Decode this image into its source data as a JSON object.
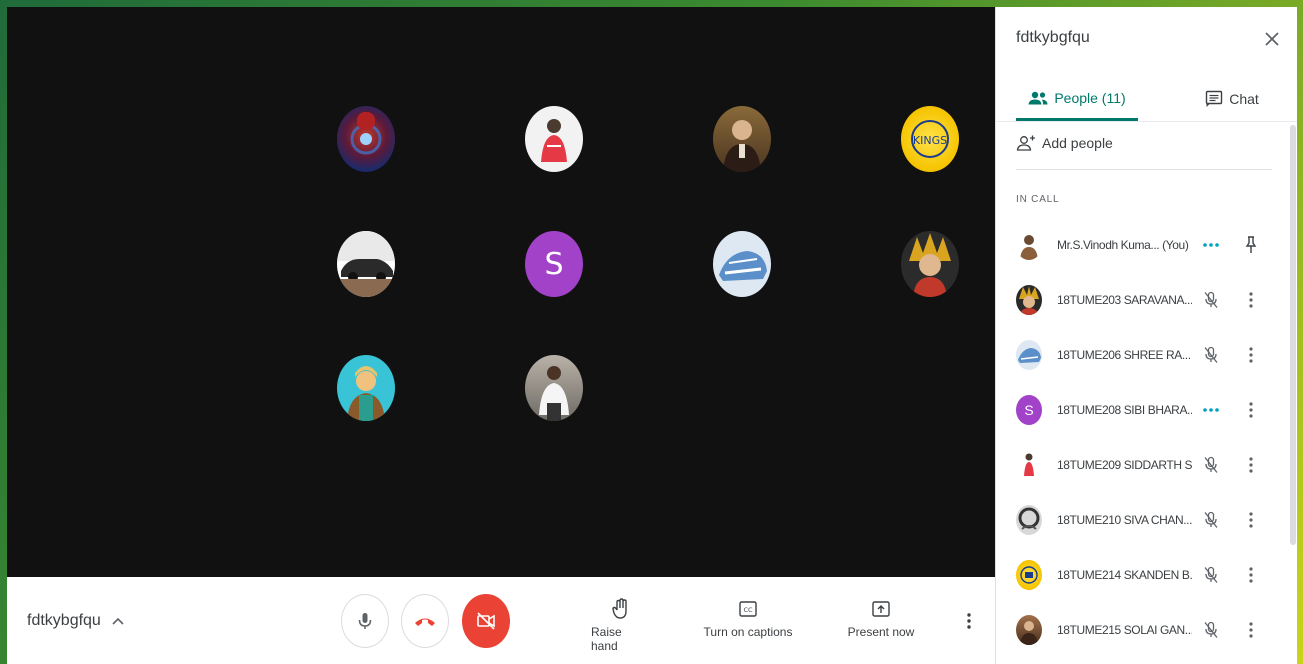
{
  "meeting": {
    "code": "fdtkybgfqu"
  },
  "colors": {
    "accent": "#00796b",
    "hangup": "#ea4335",
    "avatar_letter": "#a142c8",
    "stage_bg": "#111111"
  },
  "tiles": [
    {
      "kind": "photo",
      "icon": "ironman-avatar-icon"
    },
    {
      "kind": "photo",
      "icon": "person-avatar-icon"
    },
    {
      "kind": "photo",
      "icon": "person-avatar-icon"
    },
    {
      "kind": "photo",
      "icon": "csk-logo-avatar-icon"
    },
    {
      "kind": "photo",
      "icon": "car-avatar-icon"
    },
    {
      "kind": "letter",
      "letter": "S"
    },
    {
      "kind": "photo",
      "icon": "shoes-avatar-icon"
    },
    {
      "kind": "photo",
      "icon": "anime-avatar-icon"
    },
    {
      "kind": "photo",
      "icon": "cartoon-avatar-icon"
    },
    {
      "kind": "photo",
      "icon": "person-avatar-icon"
    }
  ],
  "controls": {
    "raise_hand": "Raise hand",
    "captions": "Turn on captions",
    "present": "Present now"
  },
  "panel": {
    "title": "fdtkybgfqu",
    "tab_people": "People (11)",
    "tab_chat": "Chat",
    "add_people": "Add people",
    "section_label": "IN CALL",
    "people": [
      {
        "name": "Mr.S.Vinodh Kuma...",
        "suffix": "(You)",
        "status": "speaking",
        "action": "pin"
      },
      {
        "name": "18TUME203 SARAVANA...",
        "status": "muted",
        "action": "more"
      },
      {
        "name": "18TUME206 SHREE RA...",
        "status": "muted",
        "action": "more"
      },
      {
        "name": "18TUME208 SIBI BHARA...",
        "letter": "S",
        "status": "speaking",
        "action": "more"
      },
      {
        "name": "18TUME209 SIDDARTH S",
        "status": "muted",
        "action": "more"
      },
      {
        "name": "18TUME210 SIVA CHAN...",
        "status": "muted",
        "action": "more"
      },
      {
        "name": "18TUME214 SKANDEN B.",
        "status": "muted",
        "action": "more"
      },
      {
        "name": "18TUME215 SOLAI GAN...",
        "status": "muted",
        "action": "more"
      }
    ]
  }
}
